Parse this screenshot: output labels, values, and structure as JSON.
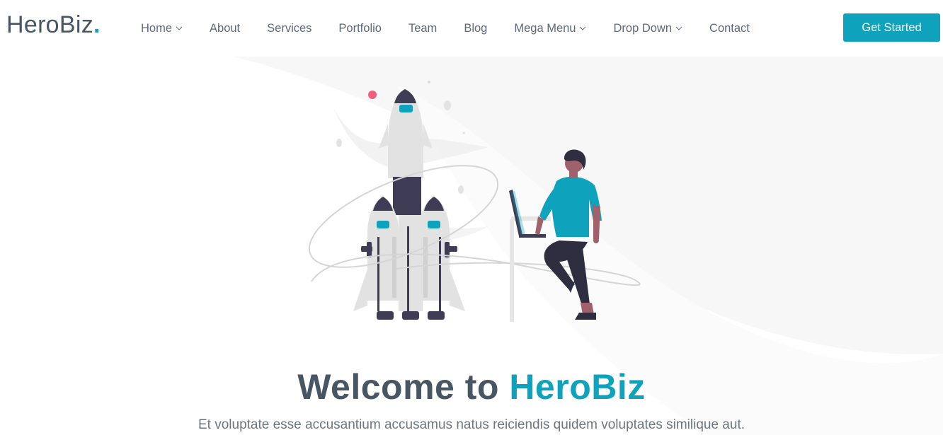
{
  "brand": {
    "name": "HeroBiz",
    "dot": "."
  },
  "nav": {
    "items": [
      {
        "label": "Home",
        "dropdown": true
      },
      {
        "label": "About",
        "dropdown": false
      },
      {
        "label": "Services",
        "dropdown": false
      },
      {
        "label": "Portfolio",
        "dropdown": false
      },
      {
        "label": "Team",
        "dropdown": false
      },
      {
        "label": "Blog",
        "dropdown": false
      },
      {
        "label": "Mega Menu",
        "dropdown": true
      },
      {
        "label": "Drop Down",
        "dropdown": true
      },
      {
        "label": "Contact",
        "dropdown": false
      }
    ],
    "cta": "Get Started"
  },
  "hero": {
    "title_prefix": "Welcome to",
    "title_accent": "HeroBiz",
    "subtitle": "Et voluptate esse accusantium accusamus natus reiciendis quidem voluptates similique aut."
  },
  "colors": {
    "accent": "#0ea2bd",
    "text": "#485664",
    "nav_text": "#5f687b"
  },
  "icons": {
    "dropdown": "chevron-down-icon",
    "illustration": "rocket-launch-illustration"
  }
}
